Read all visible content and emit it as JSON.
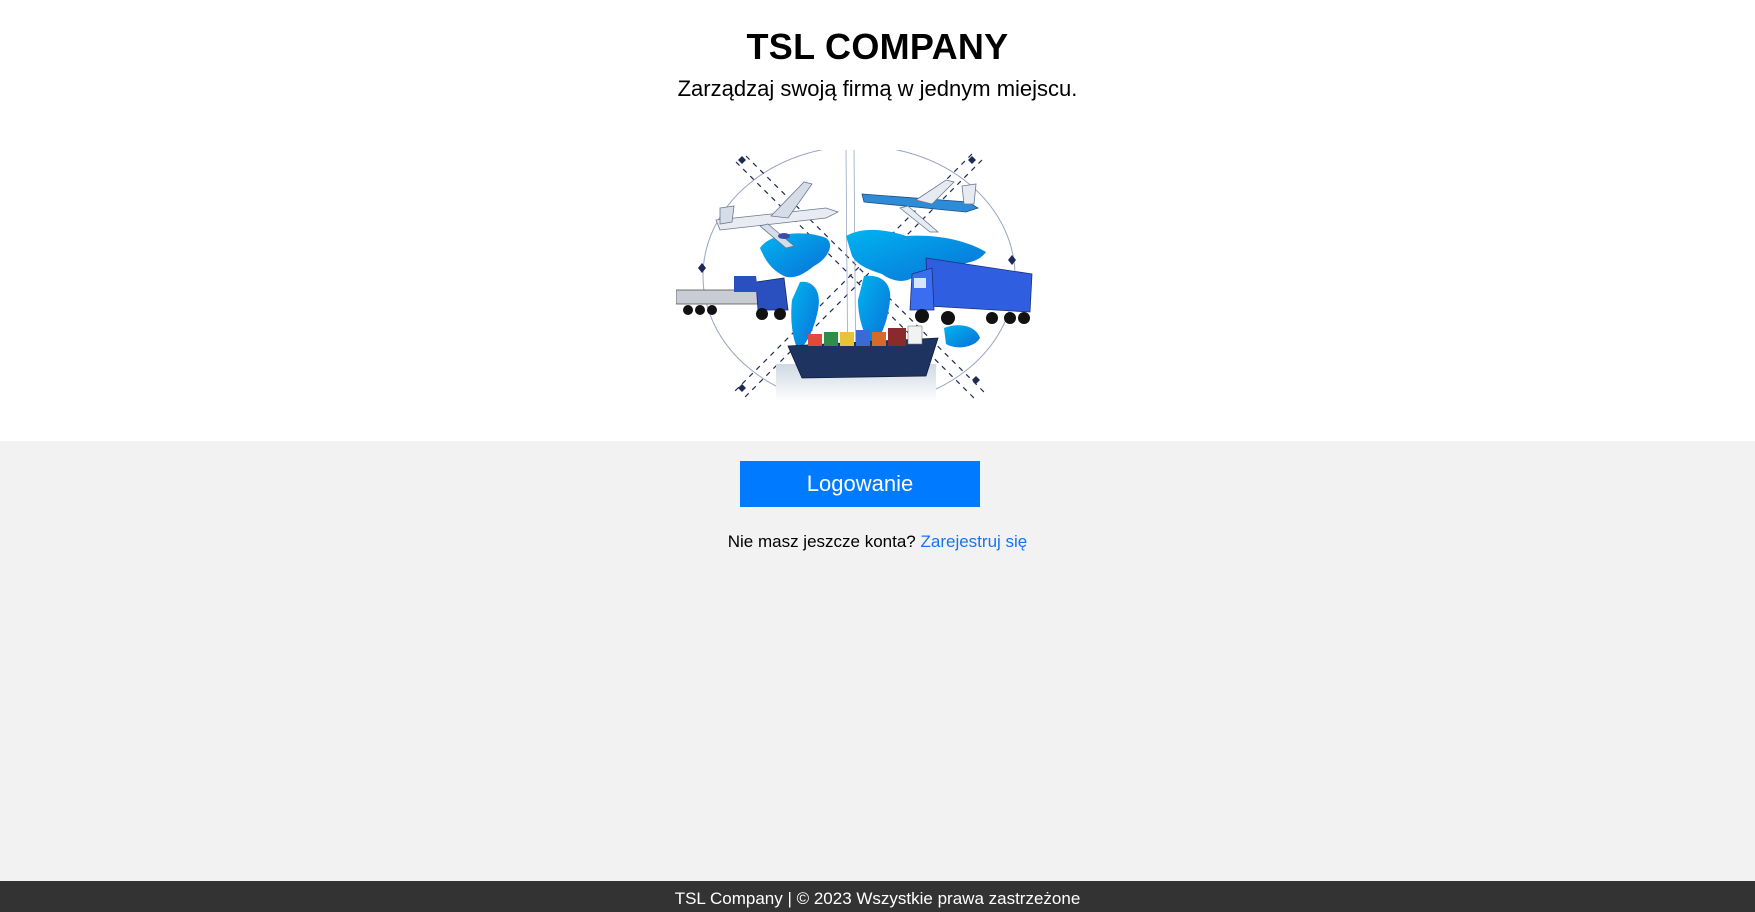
{
  "hero": {
    "title": "TSL COMPANY",
    "tagline": "Zarządzaj swoją firmą w jednym miejscu."
  },
  "login": {
    "button_label": "Logowanie"
  },
  "register": {
    "prompt": "Nie masz jeszcze konta?",
    "link_label": "Zarejestruj się"
  },
  "footer": {
    "text": "TSL Company | © 2023 Wszystkie prawa zastrzeżone"
  },
  "colors": {
    "primary": "#007bff",
    "link": "#1a73e8",
    "footer_bg": "#333333",
    "main_bg": "#f2f2f2"
  },
  "icons": [
    "logistics-globe-illustration",
    "airplane-icon",
    "truck-icon",
    "cargo-ship-icon"
  ]
}
